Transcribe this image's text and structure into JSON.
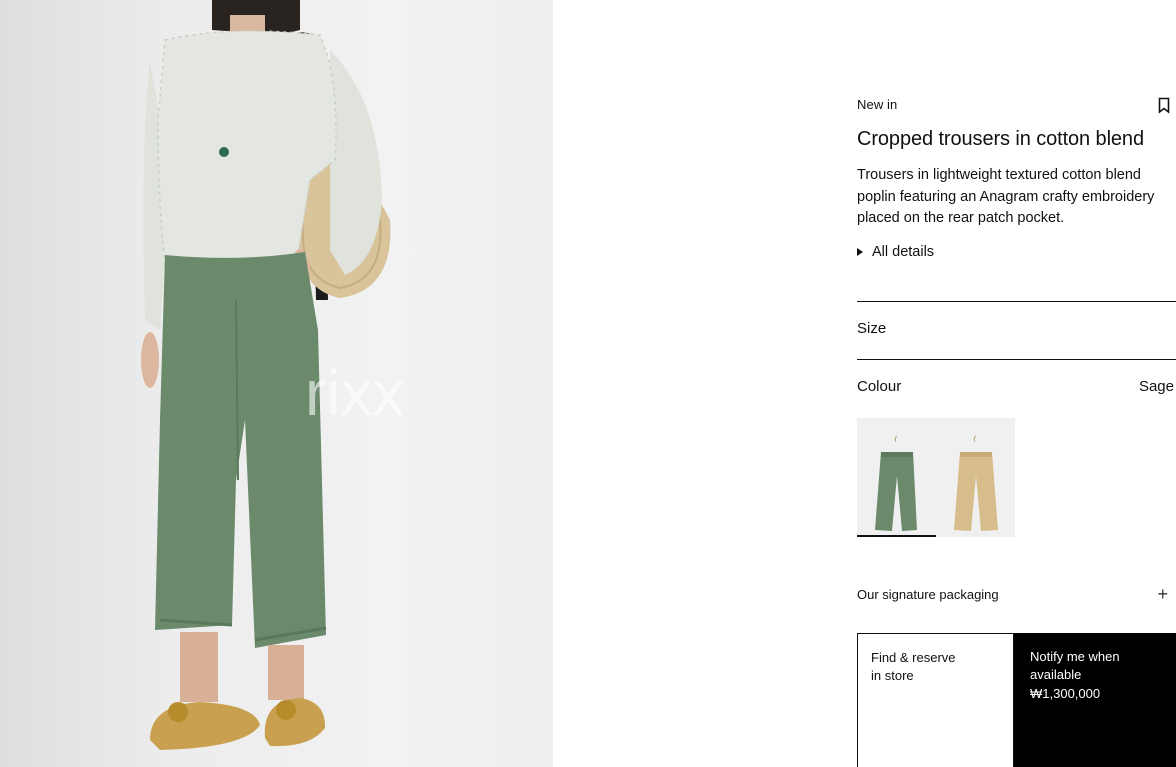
{
  "hero": {
    "image_alt": "Model wearing sage cropped trousers",
    "watermark": "rixx"
  },
  "product": {
    "eyebrow": "New in",
    "title": "Cropped trousers in cotton blend",
    "description": "Trousers in lightweight textured cotton blend poplin featuring an Anagram crafty embroidery placed on the rear patch pocket.",
    "details_label": "All details"
  },
  "size": {
    "label": "Size"
  },
  "colour": {
    "label": "Colour",
    "selected": "Sage",
    "options": [
      {
        "name": "Sage",
        "color": "#6b8a6c"
      },
      {
        "name": "Beige",
        "color": "#d8bd8c"
      }
    ]
  },
  "packaging": {
    "label": "Our signature packaging"
  },
  "actions": {
    "store_line1": "Find & reserve",
    "store_line2": "in store",
    "notify_line1": "Notify me when",
    "notify_line2": "available",
    "price": "₩1,300,000"
  },
  "colors": {
    "sage": "#6b8a6c",
    "black": "#000000"
  }
}
